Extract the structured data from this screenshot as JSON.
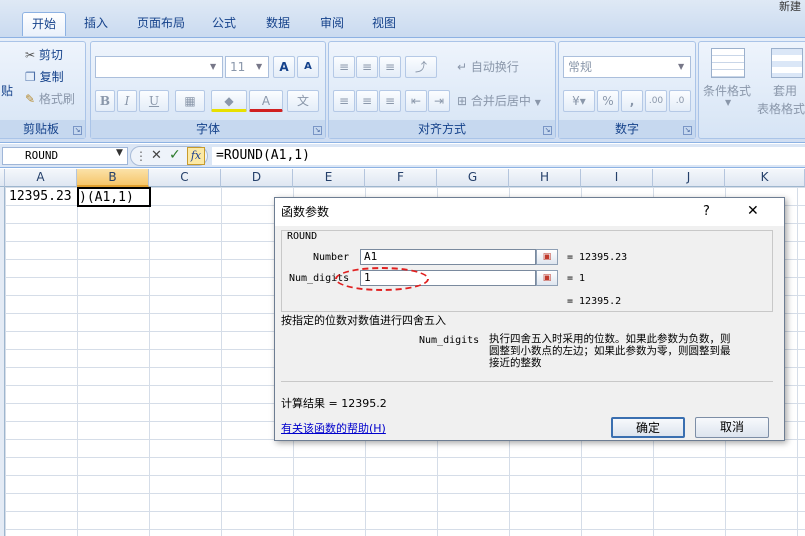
{
  "tabs": [
    "开始",
    "插入",
    "页面布局",
    "公式",
    "数据",
    "审阅",
    "视图"
  ],
  "title_fragment": "新建",
  "ribbon": {
    "clipboard": {
      "paste": "贴",
      "cut": "剪切",
      "copy": "复制",
      "format_painter": "格式刷",
      "label": "剪贴板"
    },
    "font": {
      "size": "11",
      "label": "字体"
    },
    "alignment": {
      "wrap": "自动换行",
      "merge": "合并后居中",
      "label": "对齐方式"
    },
    "number": {
      "format": "常规",
      "label": "数字"
    },
    "styles": {
      "conditional": "条件格式",
      "table": "套用",
      "table2": "表格格式"
    }
  },
  "formula_bar": {
    "name_box": "ROUND",
    "formula": "=ROUND(A1,1)"
  },
  "columns": [
    "A",
    "B",
    "C",
    "D",
    "E",
    "F",
    "G",
    "H",
    "I",
    "J",
    "K"
  ],
  "cells": {
    "A1": "12395.23",
    "B1": ")(A1,1)"
  },
  "dialog": {
    "title": "函数参数",
    "help": "?",
    "close": "✕",
    "function_name": "ROUND",
    "arg1_label": "Number",
    "arg1_value": "A1",
    "arg1_result": "= 12395.23",
    "arg2_label": "Num_digits",
    "arg2_value": "1",
    "arg2_result": "= 1",
    "result_line": "= 12395.2",
    "description": "按指定的位数对数值进行四舍五入",
    "param_name": "Num_digits",
    "param_desc_1": "执行四舍五入时采用的位数。如果此参数为负数，则",
    "param_desc_2": "圆整到小数点的左边；如果此参数为零，则圆整到最",
    "param_desc_3": "接近的整数",
    "calc_result": "计算结果 = 12395.2",
    "help_link": "有关该函数的帮助(H)",
    "ok": "确定",
    "cancel": "取消"
  },
  "colors": {
    "accent": "#15428b",
    "highlight_ring": "#e02020"
  }
}
